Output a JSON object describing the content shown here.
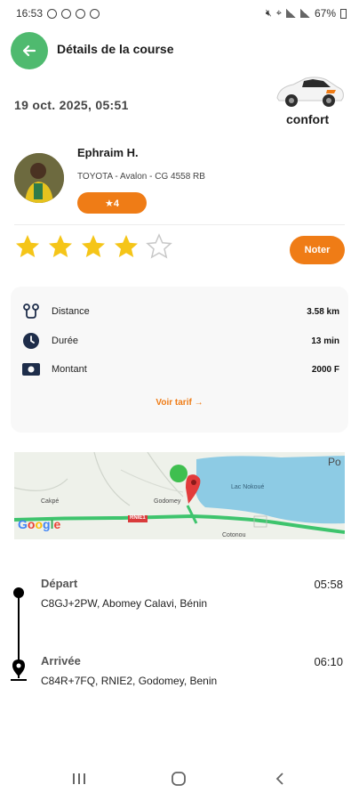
{
  "status_bar": {
    "time": "16:53",
    "battery": "67%"
  },
  "header": {
    "title": "Détails de la course"
  },
  "trip": {
    "date": "19 oct. 2025, 05:51",
    "category": "confort"
  },
  "driver": {
    "name": "Ephraim H.",
    "vehicle": "TOYOTA - Avalon - CG 4558 RB",
    "rating": "★4"
  },
  "rating_widget": {
    "filled_stars": 4,
    "total_stars": 5,
    "button_label": "Noter"
  },
  "info": {
    "rows": [
      {
        "label": "Distance",
        "value": "3.58 km",
        "icon": "route-icon"
      },
      {
        "label": "Durée",
        "value": "13 min",
        "icon": "clock-icon"
      },
      {
        "label": "Montant",
        "value": "2000 F",
        "icon": "money-icon"
      }
    ],
    "tariff_link": "Voir tarif →"
  },
  "map": {
    "labels": {
      "lake": "Lac Nokoué",
      "city_left": "Cakpé",
      "city_mid": "Godomey",
      "road": "RNIE1",
      "city_right": "Cotonou",
      "corner": "Po",
      "google": "Google"
    }
  },
  "route": {
    "departure": {
      "label": "Départ",
      "address": "C8GJ+2PW, Abomey Calavi, Bénin",
      "time": "05:58"
    },
    "arrival": {
      "label": "Arrivée",
      "address": "C84R+7FQ, RNIE2, Godomey, Benin",
      "time": "06:10"
    }
  },
  "colors": {
    "accent": "#ef7c16",
    "back_button": "#4fba6f",
    "star": "#f5c518",
    "water": "#7ec8e6",
    "road": "#3ec46d"
  }
}
